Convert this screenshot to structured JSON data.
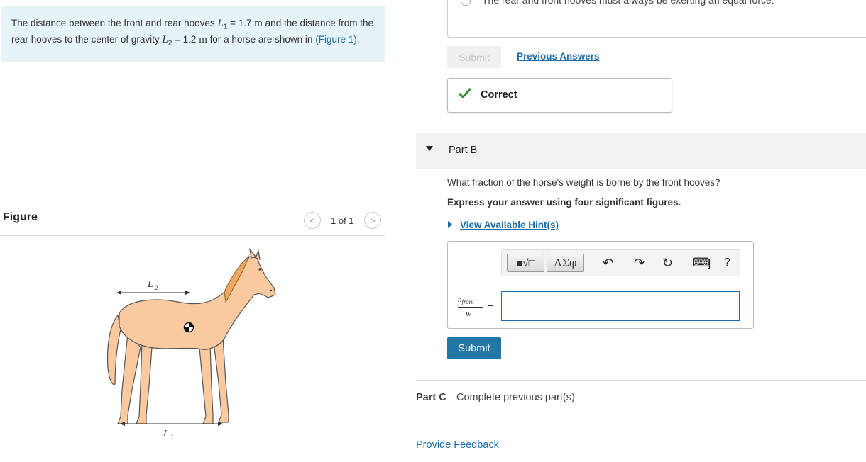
{
  "problem": {
    "text_1": "The distance between the front and rear hooves ",
    "L1_symbol": "L",
    "L1_sub": "1",
    "L1_value": " = 1.7 ",
    "unit_m": "m",
    "text_2": " and the distance from the rear hooves to the center of gravity ",
    "L2_symbol": "L",
    "L2_sub": "2",
    "L2_value": " = 1.2 ",
    "text_3": " for a horse are shown in ",
    "figure_link": "(Figure 1)",
    "text_4": "."
  },
  "figure": {
    "label": "Figure",
    "counter": "1 of 1",
    "prev_glyph": "<",
    "next_glyph": ">",
    "L2_label": "L",
    "L2_sub": "2",
    "L1_label": "L",
    "L1_sub": "1"
  },
  "part_a": {
    "selected_answer": "The rear and front hooves must always be exerting an equal force.",
    "submit_label": "Submit",
    "previous_answers_label": "Previous Answers",
    "feedback_label": "Correct"
  },
  "part_b": {
    "title": "Part B",
    "question": "What fraction of the horse's weight is borne by the front hooves?",
    "instruction": "Express your answer using four significant figures.",
    "hint_label": "View Available Hint(s)",
    "toolbar": {
      "templates_label": "■√□",
      "greek_label": "ΑΣφ",
      "undo_glyph": "↶",
      "redo_glyph": "↷",
      "reset_glyph": "↻",
      "keyboard_glyph": "⌨",
      "bracket_glyph": "]",
      "help_glyph": "?"
    },
    "fraction_numerator": "n_front",
    "numerator_main": "n",
    "numerator_sub": "front",
    "fraction_denominator": "w",
    "equals": "=",
    "answer_value": "",
    "submit_label": "Submit"
  },
  "part_c": {
    "title": "Part C",
    "status": "Complete previous part(s)"
  },
  "footer": {
    "feedback_link": "Provide Feedback"
  },
  "colors": {
    "link": "#1b6ca8",
    "problem_bg": "#e7f4f7",
    "submit_bg": "#2277a6",
    "check": "#2e8b2e",
    "horse_fill": "#f9c9a0"
  },
  "icons": [
    "check-icon",
    "undo-icon",
    "redo-icon",
    "reset-icon",
    "keyboard-icon",
    "help-icon",
    "chevron-left-icon",
    "chevron-right-icon",
    "caret-down-icon",
    "caret-right-icon"
  ]
}
